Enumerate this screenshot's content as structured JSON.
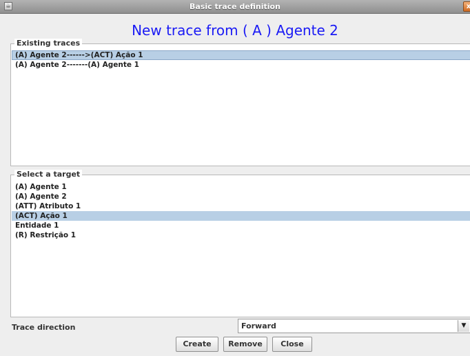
{
  "window": {
    "title": "Basic trace definition",
    "close_glyph": "x",
    "app_icon": "java-app-icon"
  },
  "heading": "New trace from ( A ) Agente 2",
  "existing_traces": {
    "legend": "Existing traces",
    "items": [
      {
        "label": "(A) Agente 2------>(ACT) Ação 1",
        "selected": true
      },
      {
        "label": "(A) Agente 2-------(A) Agente 1",
        "selected": false
      }
    ]
  },
  "targets": {
    "legend": "Select a target",
    "items": [
      {
        "label": "(A) Agente 1",
        "selected": false
      },
      {
        "label": "(A) Agente 2",
        "selected": false
      },
      {
        "label": "(ATT) Atributo 1",
        "selected": false
      },
      {
        "label": "(ACT) Ação 1",
        "selected": true
      },
      {
        "label": "Entidade 1",
        "selected": false
      },
      {
        "label": "(R) Restrição 1",
        "selected": false
      }
    ]
  },
  "trace_direction": {
    "label": "Trace direction",
    "selected": "Forward",
    "arrow_icon": "chevron-down-icon"
  },
  "buttons": {
    "create": "Create",
    "remove": "Remove",
    "close": "Close"
  },
  "colors": {
    "heading": "#1a1af5",
    "selection": "#b8cfe5"
  }
}
